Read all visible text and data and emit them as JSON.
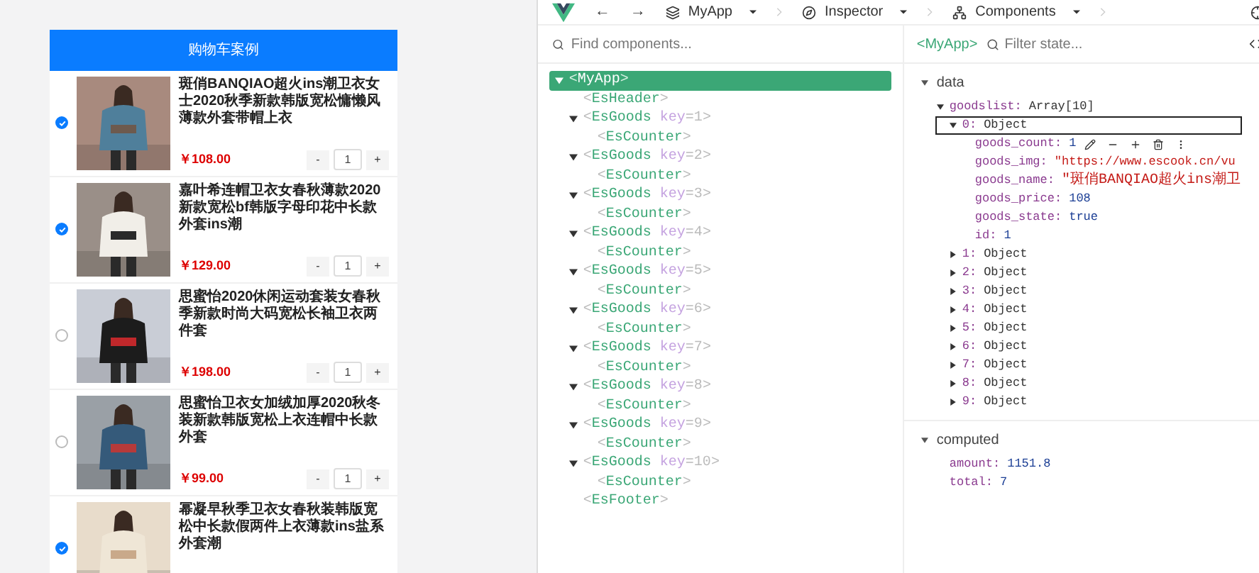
{
  "shop": {
    "header": "购物车案例",
    "goods": [
      {
        "name": "斑俏BANQIAO超火ins潮卫衣女士2020秋季新款韩版宽松慵懒风薄款外套带帽上衣",
        "price": "￥108.00",
        "count": "1",
        "selected": true,
        "dec": "-",
        "inc": "+"
      },
      {
        "name": "嘉叶希连帽卫衣女春秋薄款2020新款宽松bf韩版字母印花中长款外套ins潮",
        "price": "￥129.00",
        "count": "1",
        "selected": true,
        "dec": "-",
        "inc": "+"
      },
      {
        "name": "思蜜怡2020休闲运动套装女春秋季新款时尚大码宽松长袖卫衣两件套",
        "price": "￥198.00",
        "count": "1",
        "selected": false,
        "dec": "-",
        "inc": "+"
      },
      {
        "name": "思蜜怡卫衣女加绒加厚2020秋冬装新款韩版宽松上衣连帽中长款外套",
        "price": "￥99.00",
        "count": "1",
        "selected": false,
        "dec": "-",
        "inc": "+"
      },
      {
        "name": "幂凝早秋季卫衣女春秋装韩版宽松中长款假两件上衣薄款ins盐系外套潮",
        "selected": true
      }
    ]
  },
  "devtools": {
    "nav": {
      "back": "←",
      "forward": "→"
    },
    "breadcrumbs": [
      {
        "label": "MyApp",
        "kind": "layers"
      },
      {
        "label": "Inspector",
        "kind": "compass"
      },
      {
        "label": "Components",
        "kind": "components"
      }
    ],
    "search": {
      "placeholder": "Find components..."
    },
    "brackets": [
      "<",
      ">"
    ],
    "tree": {
      "name": "MyApp",
      "selected": true,
      "expanded": true,
      "children": [
        {
          "name": "EsHeader"
        },
        {
          "name": "EsGoods",
          "attr": "key",
          "value": "=1",
          "expanded": true,
          "children": [
            {
              "name": "EsCounter"
            }
          ]
        },
        {
          "name": "EsGoods",
          "attr": "key",
          "value": "=2",
          "expanded": true,
          "children": [
            {
              "name": "EsCounter"
            }
          ]
        },
        {
          "name": "EsGoods",
          "attr": "key",
          "value": "=3",
          "expanded": true,
          "children": [
            {
              "name": "EsCounter"
            }
          ]
        },
        {
          "name": "EsGoods",
          "attr": "key",
          "value": "=4",
          "expanded": true,
          "children": [
            {
              "name": "EsCounter"
            }
          ]
        },
        {
          "name": "EsGoods",
          "attr": "key",
          "value": "=5",
          "expanded": true,
          "children": [
            {
              "name": "EsCounter"
            }
          ]
        },
        {
          "name": "EsGoods",
          "attr": "key",
          "value": "=6",
          "expanded": true,
          "children": [
            {
              "name": "EsCounter"
            }
          ]
        },
        {
          "name": "EsGoods",
          "attr": "key",
          "value": "=7",
          "expanded": true,
          "children": [
            {
              "name": "EsCounter"
            }
          ]
        },
        {
          "name": "EsGoods",
          "attr": "key",
          "value": "=8",
          "expanded": true,
          "children": [
            {
              "name": "EsCounter"
            }
          ]
        },
        {
          "name": "EsGoods",
          "attr": "key",
          "value": "=9",
          "expanded": true,
          "children": [
            {
              "name": "EsCounter"
            }
          ]
        },
        {
          "name": "EsGoods",
          "attr": "key",
          "value": "=10",
          "expanded": true,
          "children": [
            {
              "name": "EsCounter"
            }
          ]
        },
        {
          "name": "EsFooter"
        }
      ]
    },
    "state": {
      "component": "<MyApp>",
      "filter_placeholder": "Filter state...",
      "sections": [
        {
          "title": "data",
          "expanded": true,
          "entries": [
            {
              "key": "goodslist:",
              "value": "Array[10]",
              "expanded": true,
              "children": [
                {
                  "key": "0:",
                  "value": "Object",
                  "expanded": true,
                  "selected": true,
                  "children": [
                    {
                      "key": "goods_count:",
                      "value": "1",
                      "kind": "number"
                    },
                    {
                      "key": "goods_img:",
                      "value": "\"https://www.escook.cn/vu",
                      "kind": "string"
                    },
                    {
                      "key": "goods_name:",
                      "value": "\"斑俏BANQIAO超火ins潮卫",
                      "kind": "string"
                    },
                    {
                      "key": "goods_price:",
                      "value": "108",
                      "kind": "number"
                    },
                    {
                      "key": "goods_state:",
                      "value": "true",
                      "kind": "number"
                    },
                    {
                      "key": "id:",
                      "value": "1",
                      "kind": "number"
                    }
                  ]
                },
                {
                  "key": "1:",
                  "value": "Object",
                  "expanded": false,
                  "selected": false
                },
                {
                  "key": "2:",
                  "value": "Object",
                  "expanded": false,
                  "selected": false
                },
                {
                  "key": "3:",
                  "value": "Object",
                  "expanded": false,
                  "selected": false
                },
                {
                  "key": "4:",
                  "value": "Object",
                  "expanded": false,
                  "selected": false
                },
                {
                  "key": "5:",
                  "value": "Object",
                  "expanded": false,
                  "selected": false
                },
                {
                  "key": "6:",
                  "value": "Object",
                  "expanded": false,
                  "selected": false
                },
                {
                  "key": "7:",
                  "value": "Object",
                  "expanded": false,
                  "selected": false
                },
                {
                  "key": "8:",
                  "value": "Object",
                  "expanded": false,
                  "selected": false
                },
                {
                  "key": "9:",
                  "value": "Object",
                  "expanded": false,
                  "selected": false
                }
              ]
            }
          ]
        },
        {
          "title": "computed",
          "expanded": true,
          "entries": [
            {
              "key": "amount:",
              "value": "1151.8",
              "kind": "number"
            },
            {
              "key": "total:",
              "value": "7",
              "kind": "number"
            }
          ]
        }
      ]
    }
  }
}
